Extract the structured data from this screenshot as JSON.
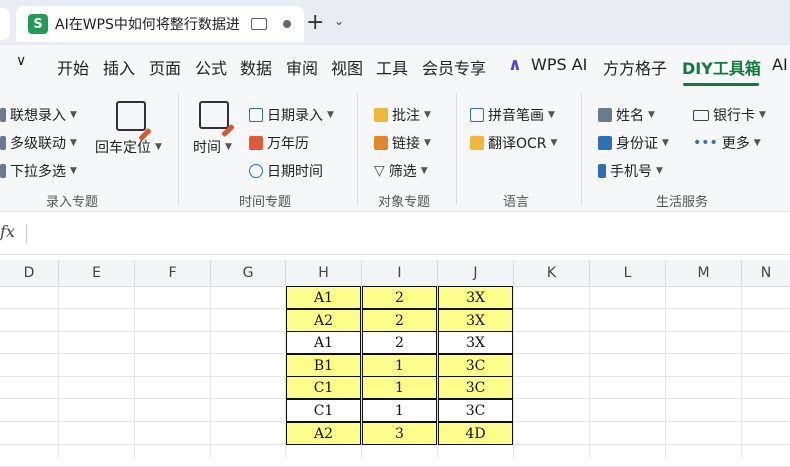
{
  "tab": {
    "title": "AI在WPS中如何将整行数据进",
    "app_icon_letter": "S"
  },
  "menu": [
    "开始",
    "插入",
    "页面",
    "公式",
    "数据",
    "审阅",
    "视图",
    "工具",
    "会员专享",
    "WPS AI",
    "方方格子",
    "DIY工具箱",
    "AI"
  ],
  "active_menu": "DIY工具箱",
  "accent": "#0f7a3d",
  "ribbon": {
    "g1": {
      "items": [
        "联想录入",
        "多级联动",
        "下拉多选"
      ],
      "big": "回车定位",
      "label": "录入专题"
    },
    "g2": {
      "big": "时间",
      "items": [
        "日期录入",
        "万年历",
        "日期时间"
      ],
      "label": "时间专题"
    },
    "g3": {
      "items": [
        "批注",
        "链接",
        "筛选"
      ],
      "label": "对象专题"
    },
    "g4": {
      "items": [
        "拼音笔画",
        "翻译OCR"
      ],
      "label": "语言"
    },
    "g5": {
      "items": [
        "姓名",
        "身份证",
        "手机号",
        "银行卡",
        "更多"
      ],
      "label": "生活服务"
    }
  },
  "formula": {
    "fx": "fx",
    "value": ""
  },
  "columns": [
    "D",
    "E",
    "F",
    "G",
    "H",
    "I",
    "J",
    "K",
    "L",
    "M",
    "N"
  ],
  "rows": [
    {
      "h": "A1",
      "i": "2",
      "j": "3X",
      "hl": true
    },
    {
      "h": "A2",
      "i": "2",
      "j": "3X",
      "hl": true
    },
    {
      "h": "A1",
      "i": "2",
      "j": "3X",
      "hl": false
    },
    {
      "h": "B1",
      "i": "1",
      "j": "3C",
      "hl": true
    },
    {
      "h": "C1",
      "i": "1",
      "j": "3C",
      "hl": true
    },
    {
      "h": "C1",
      "i": "1",
      "j": "3C",
      "hl": false
    },
    {
      "h": "A2",
      "i": "3",
      "j": "4D",
      "hl": true
    }
  ],
  "highlight_color": "#fdfd8a"
}
